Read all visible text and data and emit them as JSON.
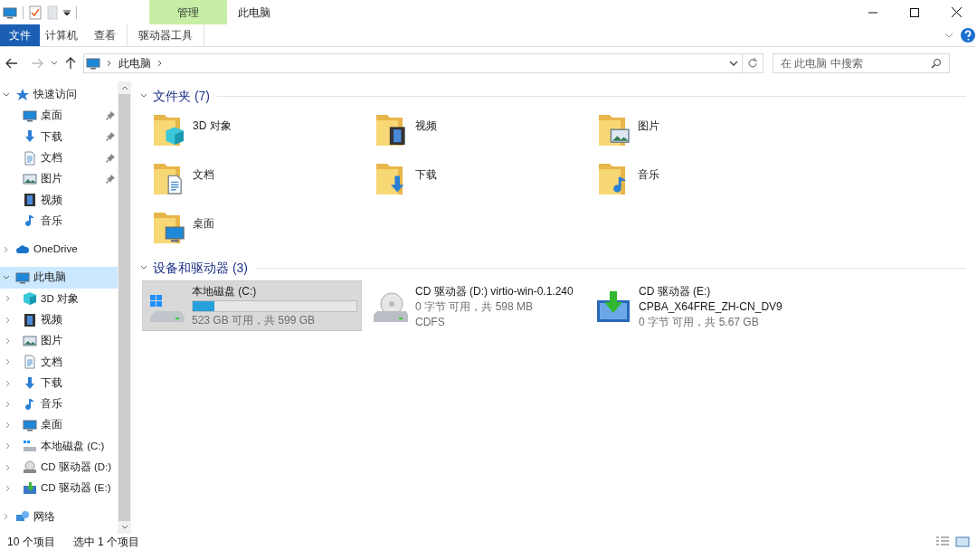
{
  "title_bar": {
    "title": "此电脑",
    "context_group": "管理"
  },
  "ribbon_tabs": [
    {
      "label": "文件",
      "kind": "file",
      "selected": false
    },
    {
      "label": "计算机",
      "kind": "plain",
      "selected": false
    },
    {
      "label": "查看",
      "kind": "plain",
      "selected": false
    },
    {
      "label": "驱动器工具",
      "kind": "contextual",
      "selected": false
    }
  ],
  "address_bar": {
    "path": [
      "此电脑"
    ]
  },
  "search": {
    "placeholder": "在 此电脑 中搜索"
  },
  "sidebar": {
    "items": [
      {
        "label": "快速访问",
        "kind": "star",
        "expanded": true,
        "selected": false,
        "children": [
          {
            "label": "桌面",
            "kind": "desktop",
            "pinned": true,
            "selected": false
          },
          {
            "label": "下载",
            "kind": "download",
            "pinned": true,
            "selected": false
          },
          {
            "label": "文档",
            "kind": "documents",
            "pinned": true,
            "selected": false
          },
          {
            "label": "图片",
            "kind": "pictures",
            "pinned": true,
            "selected": false
          },
          {
            "label": "视频",
            "kind": "videos",
            "pinned": false,
            "selected": false
          },
          {
            "label": "音乐",
            "kind": "music",
            "pinned": false,
            "selected": false
          }
        ]
      },
      {
        "label": "OneDrive",
        "kind": "cloud",
        "expanded": false,
        "selected": false
      },
      {
        "label": "此电脑",
        "kind": "pc",
        "expanded": true,
        "selected": true,
        "children": [
          {
            "label": "3D 对象",
            "kind": "cube",
            "expanded": false,
            "selected": false
          },
          {
            "label": "视频",
            "kind": "videos",
            "expanded": false,
            "selected": false
          },
          {
            "label": "图片",
            "kind": "pictures",
            "expanded": false,
            "selected": false
          },
          {
            "label": "文档",
            "kind": "documents",
            "expanded": false,
            "selected": false
          },
          {
            "label": "下载",
            "kind": "download",
            "expanded": false,
            "selected": false
          },
          {
            "label": "音乐",
            "kind": "music",
            "expanded": false,
            "selected": false
          },
          {
            "label": "桌面",
            "kind": "desktop",
            "expanded": false,
            "selected": false
          },
          {
            "label": "本地磁盘 (C:)",
            "kind": "drive",
            "expanded": false,
            "selected": false
          },
          {
            "label": "CD 驱动器 (D:)",
            "kind": "cd",
            "expanded": false,
            "selected": false
          },
          {
            "label": "CD 驱动器 (E:)",
            "kind": "setup",
            "expanded": false,
            "selected": false
          }
        ]
      },
      {
        "label": "网络",
        "kind": "network",
        "expanded": false,
        "selected": false
      }
    ]
  },
  "folders_section": {
    "heading": "文件夹 (7)",
    "expanded": true,
    "items": [
      {
        "label": "3D 对象",
        "kind": "cube"
      },
      {
        "label": "视频",
        "kind": "videos"
      },
      {
        "label": "图片",
        "kind": "pictures"
      },
      {
        "label": "文档",
        "kind": "documents"
      },
      {
        "label": "下载",
        "kind": "download"
      },
      {
        "label": "音乐",
        "kind": "music"
      },
      {
        "label": "桌面",
        "kind": "desktop"
      }
    ]
  },
  "drives_section": {
    "heading": "设备和驱动器 (3)",
    "expanded": true,
    "items": [
      {
        "name": "本地磁盘 (C:)",
        "kind": "drive",
        "selected": true,
        "level": 0.13,
        "detail": "523 GB 可用，共 599 GB"
      },
      {
        "name": "CD 驱动器 (D:) virtio-win-0.1.240",
        "kind": "cd",
        "selected": false,
        "detail": "0 字节 可用，共 598 MB",
        "filesystem": "CDFS"
      },
      {
        "name": "CD 驱动器 (E:)",
        "kind": "setup",
        "selected": false,
        "volume": "CPBA_X64FRE_ZH-CN_DV9",
        "detail": "0 字节 可用，共 5.67 GB"
      }
    ]
  },
  "status_bar": {
    "count": "10 个项目",
    "selection": "选中 1 个项目"
  }
}
